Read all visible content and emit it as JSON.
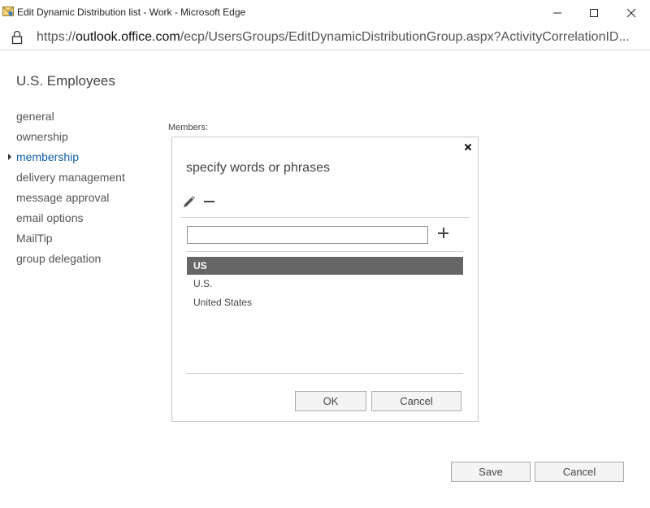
{
  "window": {
    "title": "Edit Dynamic Distribution list - Work - Microsoft Edge",
    "icons": {
      "app": "mail-envelope-icon",
      "minimize": "minimize-icon",
      "maximize": "maximize-icon",
      "close": "close-icon"
    }
  },
  "address": {
    "scheme": "https://",
    "host": "outlook.office.com",
    "path": "/ecp/UsersGroups/EditDynamicDistributionGroup.aspx?ActivityCorrelationID...",
    "icon": "lock-icon"
  },
  "page": {
    "title": "U.S. Employees",
    "nav": [
      {
        "label": "general"
      },
      {
        "label": "ownership"
      },
      {
        "label": "membership",
        "active": true
      },
      {
        "label": "delivery management"
      },
      {
        "label": "message approval"
      },
      {
        "label": "email options"
      },
      {
        "label": "MailTip"
      },
      {
        "label": "group delegation"
      }
    ],
    "members_label": "Members:"
  },
  "dialog": {
    "title": "specify words or phrases",
    "input_value": "",
    "icons": {
      "close": "close-icon",
      "edit": "pencil-icon",
      "remove": "minus-icon",
      "add": "plus-icon"
    },
    "items": [
      {
        "label": "US",
        "selected": true
      },
      {
        "label": "U.S."
      },
      {
        "label": "United States"
      }
    ],
    "ok_label": "OK",
    "cancel_label": "Cancel"
  },
  "footer": {
    "save_label": "Save",
    "cancel_label": "Cancel"
  },
  "colors": {
    "accent": "#0f5ea8",
    "selected_row": "#666666"
  }
}
